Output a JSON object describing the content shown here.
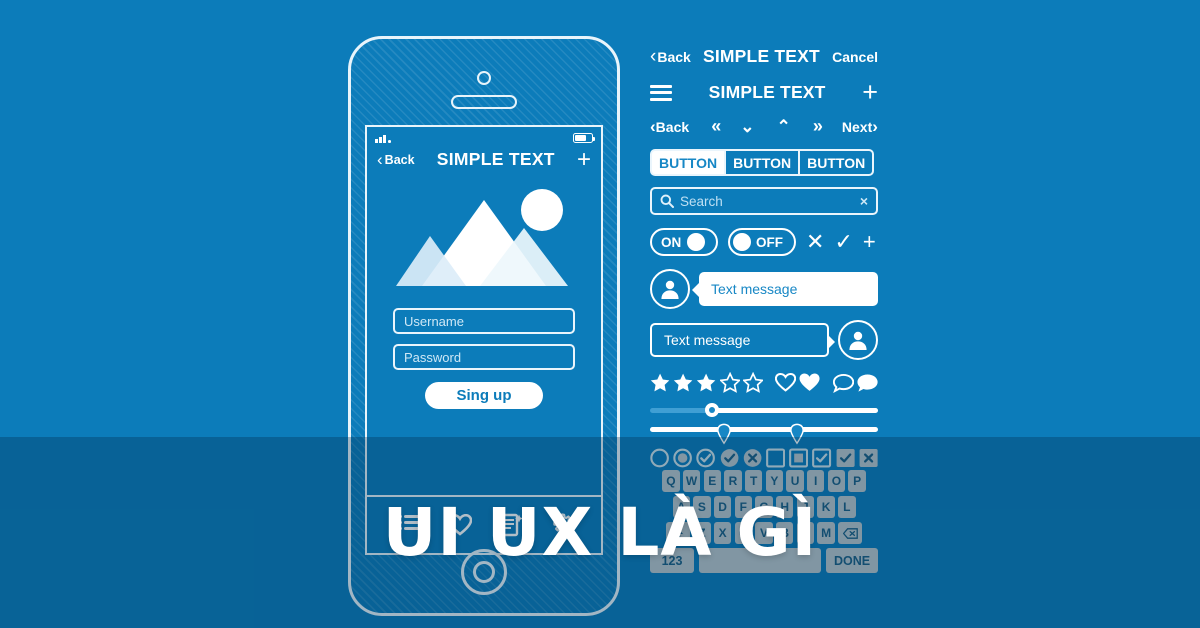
{
  "banner": {
    "title": "UI UX LÀ GÌ",
    "bg_color": "#0c7cba",
    "overlay_color": "rgba(0,40,70,0.30)",
    "accent_white": "#ffffff"
  },
  "phone": {
    "statusbar": {
      "signal_icon": "signal-bars-icon",
      "battery_icon": "battery-icon"
    },
    "navbar": {
      "back_label": "Back",
      "title": "SIMPLE TEXT",
      "add_label": "+"
    },
    "hero": {
      "image_icon": "mountains-sun-image-placeholder"
    },
    "form": {
      "username_placeholder": "Username",
      "password_placeholder": "Password",
      "signup_label": "Sing up"
    },
    "tabbar": {
      "items": [
        {
          "icon": "list-icon"
        },
        {
          "icon": "heart-icon"
        },
        {
          "icon": "document-add-icon"
        },
        {
          "icon": "gear-icon"
        }
      ]
    }
  },
  "kit": {
    "topbar": {
      "back_label": "Back",
      "title": "SIMPLE TEXT",
      "cancel_label": "Cancel"
    },
    "menubar": {
      "menu_icon": "hamburger-icon",
      "title": "SIMPLE TEXT",
      "add_label": "+"
    },
    "pager": {
      "back_label": "Back",
      "first_label": "«",
      "down_label": "⌄",
      "up_label": "⌃",
      "last_label": "»",
      "next_label": "Next"
    },
    "buttons": [
      {
        "label": "BUTTON",
        "state": "active"
      },
      {
        "label": "BUTTON",
        "state": "default"
      },
      {
        "label": "BUTTON",
        "state": "default"
      }
    ],
    "search": {
      "icon": "search-icon",
      "placeholder": "Search",
      "clear_label": "×"
    },
    "toggles": [
      {
        "label": "ON",
        "state": "on"
      },
      {
        "label": "OFF",
        "state": "off"
      }
    ],
    "actions": [
      {
        "icon": "close-icon",
        "glyph": "✕"
      },
      {
        "icon": "check-icon",
        "glyph": "✓"
      },
      {
        "icon": "plus-icon",
        "glyph": "+"
      }
    ],
    "chat": [
      {
        "avatar": "user-avatar-icon",
        "message": "Text message",
        "side": "left"
      },
      {
        "avatar": "user-avatar-icon",
        "message": "Text message",
        "side": "right"
      }
    ],
    "rating": {
      "stars_filled": 3,
      "stars_total": 5,
      "icons": [
        "heart-outline-icon",
        "heart-filled-icon",
        "comment-outline-icon",
        "comment-filled-icon"
      ]
    },
    "sliders": [
      {
        "type": "single",
        "value": 25
      },
      {
        "type": "range",
        "values": [
          30,
          62
        ]
      }
    ],
    "selectors": [
      {
        "shape": "circle",
        "state": "empty"
      },
      {
        "shape": "circle",
        "state": "dot"
      },
      {
        "shape": "circle",
        "state": "check-outline"
      },
      {
        "shape": "circle",
        "state": "check-filled"
      },
      {
        "shape": "circle",
        "state": "cross-filled"
      },
      {
        "shape": "square",
        "state": "empty"
      },
      {
        "shape": "square",
        "state": "dot"
      },
      {
        "shape": "square",
        "state": "check-outline"
      },
      {
        "shape": "square",
        "state": "check-filled"
      },
      {
        "shape": "square",
        "state": "cross-filled"
      }
    ]
  },
  "keyboard": {
    "row1": [
      "Q",
      "W",
      "E",
      "R",
      "T",
      "Y",
      "U",
      "I",
      "O",
      "P"
    ],
    "row2": [
      "A",
      "S",
      "D",
      "F",
      "G",
      "H",
      "J",
      "K",
      "L"
    ],
    "row3": [
      "Z",
      "X",
      "C",
      "V",
      "B",
      "N",
      "M"
    ],
    "shift_icon": "shift-icon",
    "backspace_icon": "backspace-icon",
    "num_label": "123",
    "space_label": "",
    "done_label": "DONE"
  }
}
